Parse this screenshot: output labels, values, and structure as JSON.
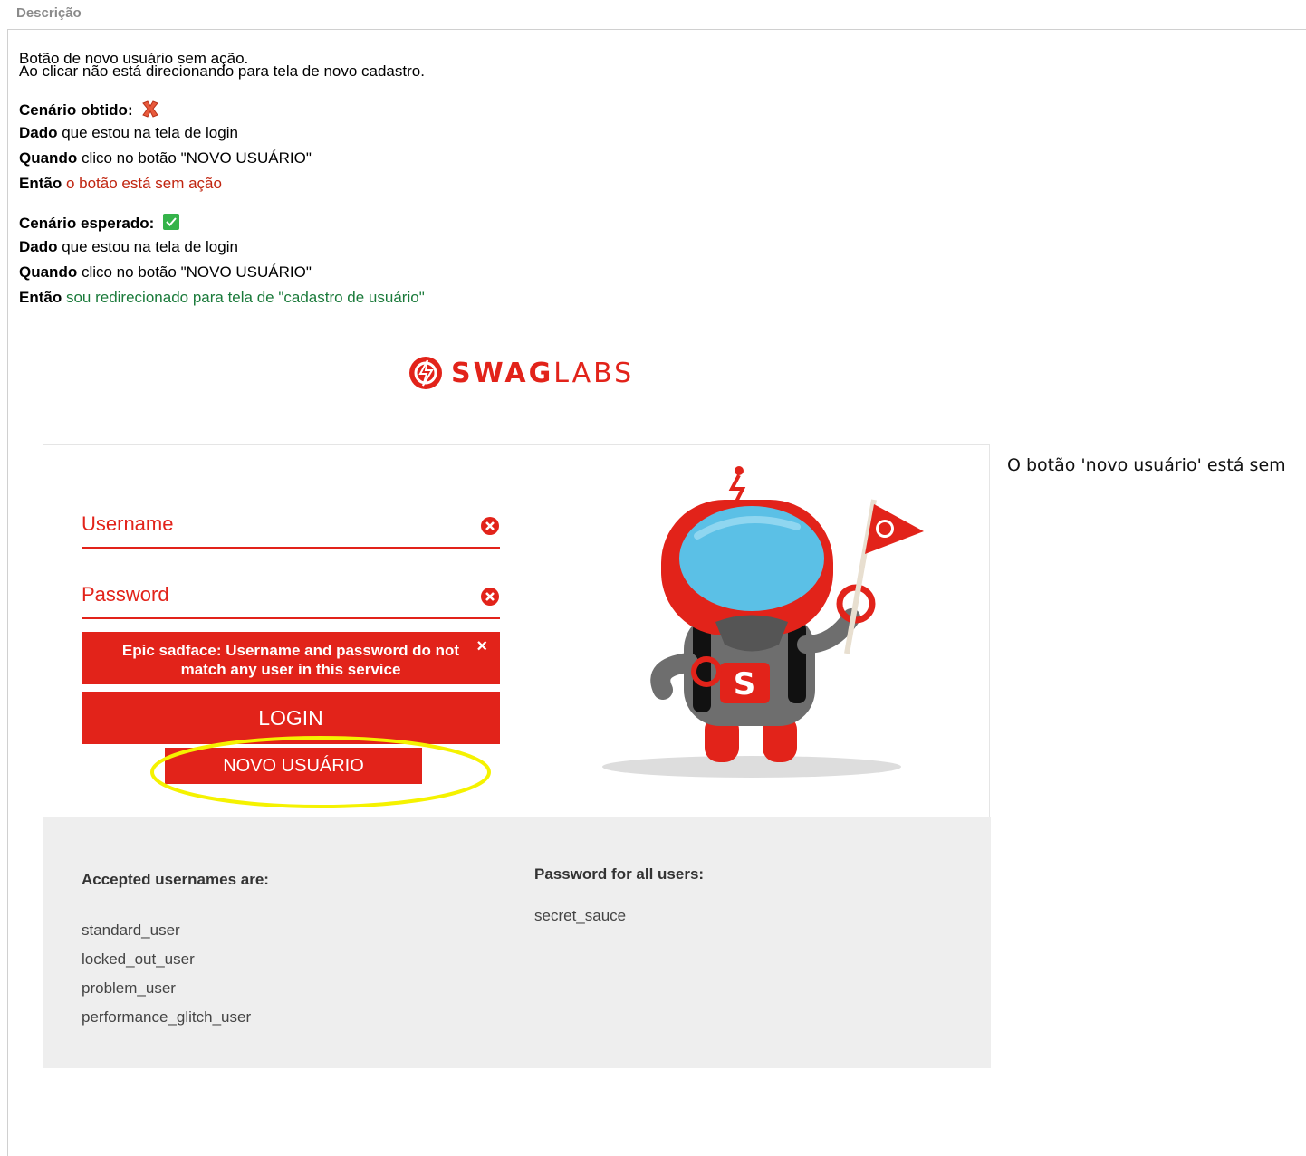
{
  "section": {
    "label": "Descrição"
  },
  "description": {
    "line1": "Botão de novo usuário sem ação.",
    "line2": "Ao clicar não está direcionando para tela de novo cadastro."
  },
  "obtained": {
    "title": "Cenário obtido:",
    "given_kw": "Dado",
    "given": " que estou na tela de login",
    "when_kw": "Quando",
    "when": " clico no botão \"NOVO USUÁRIO\"",
    "then_kw": "Então",
    "then": " o botão está sem ação"
  },
  "expected": {
    "title": "Cenário esperado:",
    "given_kw": "Dado",
    "given": " que estou na tela de login",
    "when_kw": "Quando",
    "when": " clico no botão \"NOVO USUÁRIO\"",
    "then_kw": "Então",
    "then": " sou redirecionado para tela de \"cadastro de usuário\""
  },
  "screenshot": {
    "logo_bold": "SWAG",
    "logo_light": "LABS",
    "username_placeholder": "Username",
    "password_placeholder": "Password",
    "error_message": "Epic sadface: Username and password do not match any user in this service",
    "error_close": "×",
    "login_label": "LOGIN",
    "novo_usuario_label": "NOVO USUÁRIO",
    "accepted_title": "Accepted usernames are:",
    "usernames": [
      "standard_user",
      "locked_out_user",
      "problem_user",
      "performance_glitch_user"
    ],
    "password_title": "Password for all users:",
    "password_value": "secret_sauce"
  },
  "side_note": "O botão 'novo usuário' está sem",
  "colors": {
    "brand_red": "#e2231a",
    "fail_red": "#c0240f",
    "pass_green": "#1a7a3a",
    "highlight_yellow": "#f5f200"
  },
  "icons": {
    "obtained": "cross-mark-icon",
    "expected": "check-mark-icon"
  }
}
